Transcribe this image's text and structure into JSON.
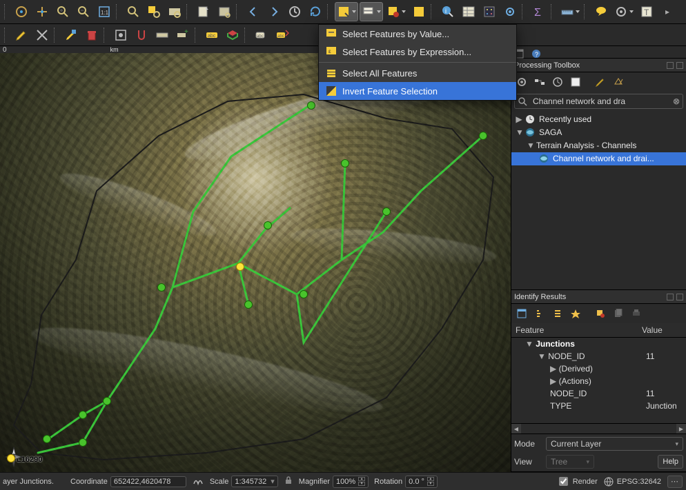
{
  "menu": {
    "items": [
      {
        "label": "Select Features by Value...",
        "icon": "filter"
      },
      {
        "label": "Select Features by Expression...",
        "icon": "expr"
      },
      {
        "label": "Select All Features",
        "icon": "all"
      },
      {
        "label": "Invert Feature Selection",
        "icon": "invert",
        "selected": true
      }
    ]
  },
  "processing": {
    "title": "Processing Toolbox",
    "search": "Channel network and dra",
    "tree": [
      {
        "l": 0,
        "label": "Recently used",
        "icon": "clock",
        "twist": "▶"
      },
      {
        "l": 0,
        "label": "SAGA",
        "icon": "saga",
        "twist": "▼"
      },
      {
        "l": 1,
        "label": "Terrain Analysis - Channels",
        "twist": "▼"
      },
      {
        "l": 2,
        "label": "Channel network and drai...",
        "icon": "saga",
        "selected": true
      }
    ]
  },
  "identify": {
    "title": "Identify Results",
    "columns": [
      "Feature",
      "Value"
    ],
    "rows": [
      {
        "f": "Junctions",
        "v": "",
        "kind": "hdr",
        "indent": 1,
        "twist": "▼"
      },
      {
        "f": "NODE_ID",
        "v": "11",
        "indent": 2,
        "twist": "▼"
      },
      {
        "f": "(Derived)",
        "v": "",
        "indent": 3,
        "twist": "▶"
      },
      {
        "f": "(Actions)",
        "v": "",
        "indent": 3,
        "twist": "▶"
      },
      {
        "f": "NODE_ID",
        "v": "11",
        "indent": 3
      },
      {
        "f": "TYPE",
        "v": "Junction",
        "indent": 3
      }
    ],
    "mode_label": "Mode",
    "mode_value": "Current Layer",
    "view_label": "View",
    "view_value": "Tree",
    "help": "Help"
  },
  "status": {
    "message": "ayer Junctions.",
    "coord_label": "Coordinate",
    "coord_value": "652422,4620478",
    "scale_label": "Scale",
    "scale_value": "1:345732",
    "mag_label": "Magnifier",
    "mag_value": "100%",
    "rot_label": "Rotation",
    "rot_value": "0.0 °",
    "render_label": "Render",
    "epsg": "EPSG:32642"
  },
  "scale_overlay": "0",
  "map_label": "L16290"
}
